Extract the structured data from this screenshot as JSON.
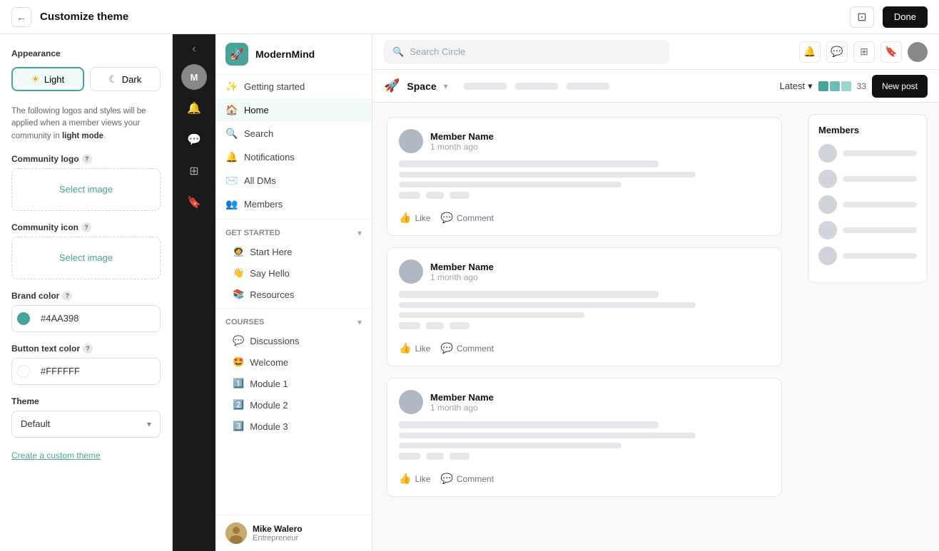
{
  "topbar": {
    "title": "Customize theme",
    "back_icon": "←",
    "preview_icon": "⊡",
    "done_label": "Done"
  },
  "left_panel": {
    "appearance_label": "Appearance",
    "light_label": "Light",
    "dark_label": "Dark",
    "info_text_1": "The following logos and styles will be applied when a member views your community in ",
    "info_text_bold": "light mode",
    "info_text_2": ".",
    "community_logo_label": "Community logo",
    "community_icon_label": "Community icon",
    "brand_color_label": "Brand color",
    "button_text_color_label": "Button text color",
    "theme_label": "Theme",
    "select_image_label": "Select image",
    "brand_color_value": "#4AA398",
    "button_text_value": "#FFFFFF",
    "theme_value": "Default",
    "create_custom_theme": "Create a custom theme"
  },
  "circle": {
    "community_name": "ModernMind",
    "community_icon": "🚀",
    "space_name": "Space",
    "search_placeholder": "Search Circle",
    "nav_items": [
      {
        "icon": "✨",
        "label": "Getting started"
      },
      {
        "icon": "🏠",
        "label": "Home",
        "active": true
      },
      {
        "icon": "🔍",
        "label": "Search"
      },
      {
        "icon": "🔔",
        "label": "Notifications"
      },
      {
        "icon": "✉️",
        "label": "All DMs"
      },
      {
        "icon": "👥",
        "label": "Members"
      }
    ],
    "get_started_label": "Get started",
    "get_started_items": [
      {
        "icon": "🧑‍🚀",
        "label": "Start Here"
      },
      {
        "icon": "👋",
        "label": "Say Hello"
      },
      {
        "icon": "📚",
        "label": "Resources"
      }
    ],
    "courses_label": "Courses",
    "courses_items": [
      {
        "icon": "💬",
        "label": "Discussions"
      },
      {
        "icon": "🤩",
        "label": "Welcome"
      },
      {
        "icon": "1️⃣",
        "label": "Module 1"
      },
      {
        "icon": "2️⃣",
        "label": "Module 2"
      },
      {
        "icon": "3️⃣",
        "label": "Module 3"
      }
    ],
    "footer_name": "Mike Walero",
    "footer_role": "Entrepreneur",
    "sort_label": "Latest",
    "new_post_label": "New post",
    "members_label": "Members",
    "post_author": "Member Name",
    "post_time": "1 month ago",
    "like_label": "Like",
    "comment_label": "Comment",
    "member_count": "33"
  }
}
